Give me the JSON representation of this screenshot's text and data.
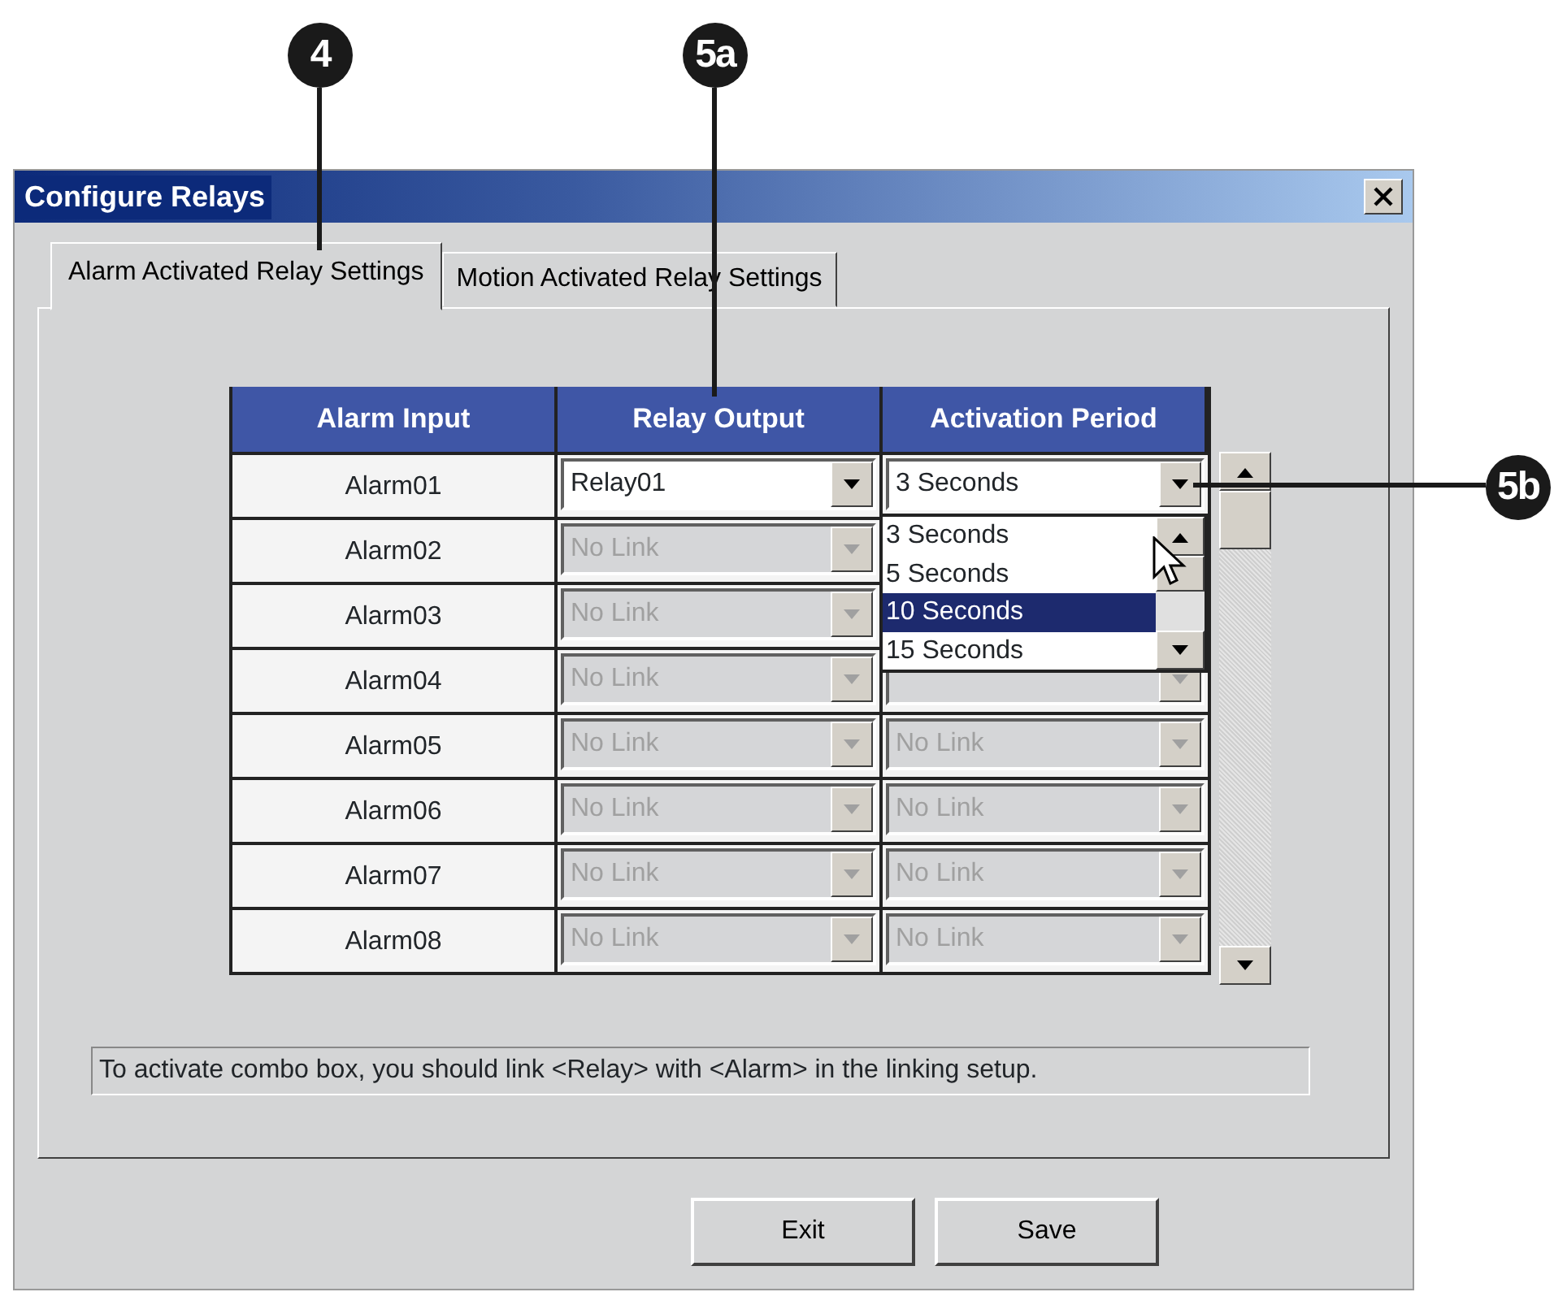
{
  "callouts": [
    {
      "label": "4"
    },
    {
      "label": "5a"
    },
    {
      "label": "5b"
    }
  ],
  "window": {
    "title": "Configure Relays"
  },
  "tabs": [
    {
      "label": "Alarm Activated Relay Settings",
      "selected": true
    },
    {
      "label": "Motion Activated Relay Settings",
      "selected": false
    }
  ],
  "table": {
    "columns": [
      "Alarm Input",
      "Relay Output",
      "Activation Period"
    ],
    "rows": [
      {
        "alarm": "Alarm01",
        "relay": {
          "value": "Relay01",
          "disabled": false
        },
        "period": {
          "value": "3 Seconds",
          "disabled": false
        }
      },
      {
        "alarm": "Alarm02",
        "relay": {
          "value": "No Link",
          "disabled": true
        }
      },
      {
        "alarm": "Alarm03",
        "relay": {
          "value": "No Link",
          "disabled": true
        }
      },
      {
        "alarm": "Alarm04",
        "relay": {
          "value": "No Link",
          "disabled": true
        },
        "period": {
          "disabled": true
        }
      },
      {
        "alarm": "Alarm05",
        "relay": {
          "value": "No Link",
          "disabled": true
        },
        "period": {
          "value": "No Link",
          "disabled": true
        }
      },
      {
        "alarm": "Alarm06",
        "relay": {
          "value": "No Link",
          "disabled": true
        },
        "period": {
          "value": "No Link",
          "disabled": true
        }
      },
      {
        "alarm": "Alarm07",
        "relay": {
          "value": "No Link",
          "disabled": true
        },
        "period": {
          "value": "No Link",
          "disabled": true
        }
      },
      {
        "alarm": "Alarm08",
        "relay": {
          "value": "No Link",
          "disabled": true
        },
        "period": {
          "value": "No Link",
          "disabled": true
        }
      }
    ]
  },
  "dropdown": {
    "items": [
      {
        "label": "3 Seconds",
        "selected": false
      },
      {
        "label": "5 Seconds",
        "selected": false
      },
      {
        "label": "10 Seconds",
        "selected": true
      },
      {
        "label": "15 Seconds",
        "selected": false
      }
    ]
  },
  "hint": "To activate combo box, you should link <Relay> with <Alarm> in the linking setup.",
  "buttons": [
    "Exit",
    "Save"
  ]
}
